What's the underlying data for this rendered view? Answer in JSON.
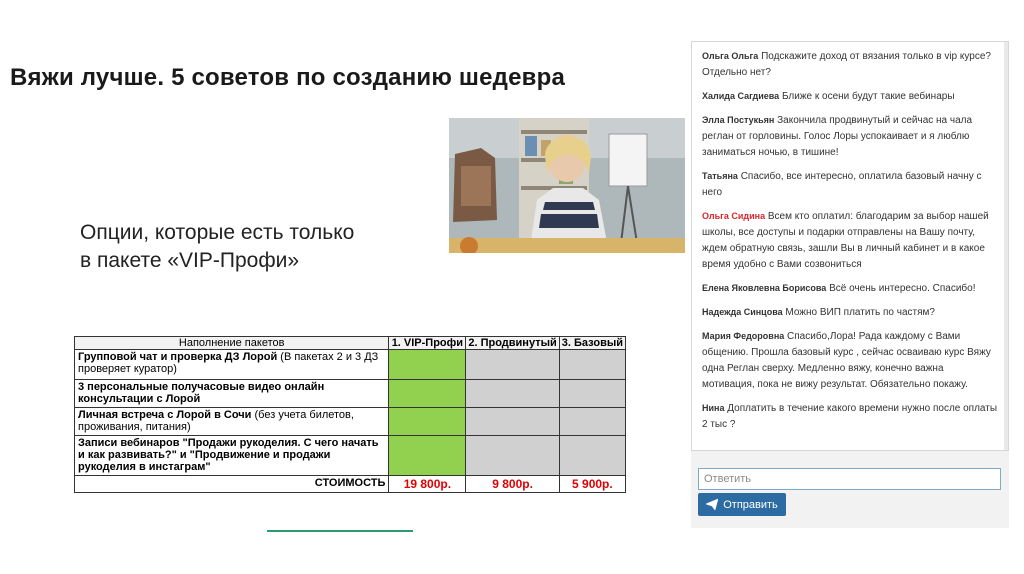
{
  "slide": {
    "title": "Вяжи лучше. 5 советов по созданию шедевра",
    "subtitle_line1": "Опции, которые есть только",
    "subtitle_line2": "в пакете «VIP-Профи»"
  },
  "table": {
    "headers": [
      "Наполнение пакетов",
      "1. VIP-Профи",
      "2. Продвинутый",
      "3. Базовый"
    ],
    "rows": [
      {
        "bold": "Групповой чат и проверка ДЗ Лорой",
        "normal": " (В пакетах 2 и 3 ДЗ проверяет куратор)"
      },
      {
        "bold": "3 персональные получасовые видео онлайн консультации с Лорой",
        "normal": ""
      },
      {
        "bold": "Личная встреча с Лорой в Сочи",
        "normal": " (без учета билетов, проживания, питания)"
      },
      {
        "bold": "Записи вебинаров \"Продажи рукоделия. С чего начать и как развивать?\" и \"Продвижение и продажи рукоделия в инстаграм\"",
        "normal": ""
      }
    ],
    "price_label": "СТОИМОСТЬ",
    "prices": [
      "19 800р.",
      "9 800р.",
      "5 900р."
    ],
    "colors": {
      "included": "#92d050",
      "excluded": "#d0d0d0",
      "price": "#e00000"
    }
  },
  "chat": {
    "messages": [
      {
        "name": "Ольга Ольга",
        "text": "Подскажите доход от вязания только в vip курсе? Отдельно нет?"
      },
      {
        "name": "Халида Сагдиева",
        "text": "Ближе к осени будут такие вебинары"
      },
      {
        "name": "Элла Постукьян",
        "text": "Закончила продвинутый и сейчас на чала реглан от горловины. Голос Лоры успокаивает и я люблю заниматься ночью, в тишине!"
      },
      {
        "name": "Татьяна",
        "text": "Спасибо, все интересно, оплатила базовый начну с него"
      },
      {
        "name": "Ольга Сидина",
        "text": "Всем кто оплатил: благодарим за выбор нашей школы, все доступы и подарки отправлены на Вашу почту, ждем обратную связь, зашли Вы в личный кабинет и в какое время удобно с Вами созвониться",
        "highlight": true
      },
      {
        "name": "Елена Яковлевна Борисова",
        "text": "Всё очень интересно. Спасибо!"
      },
      {
        "name": "Надежда Синцова",
        "text": "Можно ВИП платить по частям?"
      },
      {
        "name": "Мария Федоровна",
        "text": "Спасибо,Лора! Рада каждому с Вами общению. Прошла базовый курс , сейчас осваиваю курс Вяжу одна Реглан сверху. Медленно вяжу, конечно важна мотивация, пока не вижу результат. Обязательно покажу."
      },
      {
        "name": "Нина",
        "text": "Доплатить в течение какого времени нужно после оплаты 2 тыс ?"
      }
    ],
    "reply_placeholder": "Ответить",
    "send_label": "Отправить",
    "send_icon": "paper-plane-icon",
    "accent": "#2d6ca2",
    "name_highlight_color": "#d9262a"
  }
}
